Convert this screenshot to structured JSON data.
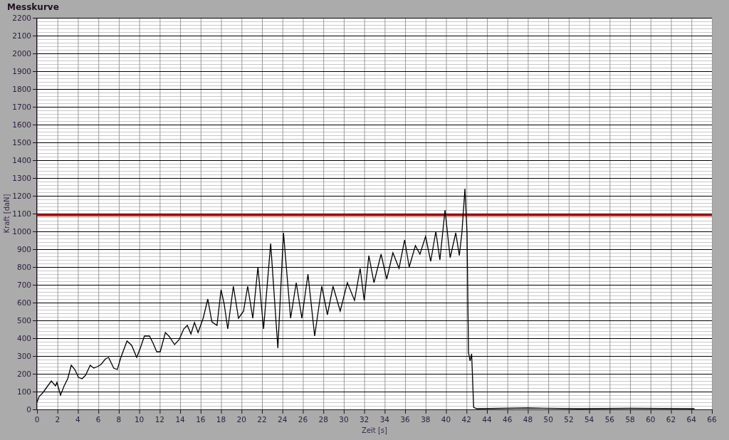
{
  "graph": {
    "title": "Messkurve",
    "chart_data": {
      "type": "line",
      "xlabel": "Zeit [s]",
      "ylabel": "Kraft [daN]",
      "x": [
        0,
        0.2,
        0.55,
        0.9,
        1.4,
        1.8,
        1.95,
        2.1,
        2.3,
        2.65,
        3.0,
        3.35,
        3.7,
        4.05,
        4.4,
        4.75,
        5.2,
        5.55,
        5.9,
        6.25,
        6.7,
        7.0,
        7.5,
        7.85,
        8.2,
        8.8,
        9.25,
        9.75,
        10.15,
        10.5,
        11.0,
        11.35,
        11.7,
        12.05,
        12.55,
        12.95,
        13.45,
        13.9,
        14.35,
        14.7,
        15.05,
        15.4,
        15.75,
        16.25,
        16.7,
        17.1,
        17.6,
        18.0,
        18.3,
        18.65,
        19.2,
        19.7,
        20.2,
        20.6,
        21.1,
        21.6,
        22.15,
        22.85,
        23.55,
        24.1,
        24.8,
        25.35,
        25.9,
        26.5,
        27.15,
        27.85,
        28.4,
        28.95,
        29.65,
        30.35,
        31.05,
        31.6,
        32.0,
        32.45,
        32.95,
        33.65,
        34.2,
        34.8,
        35.4,
        35.95,
        36.4,
        37.0,
        37.45,
        38.0,
        38.5,
        39.0,
        39.4,
        39.9,
        40.4,
        40.95,
        41.3,
        41.55,
        41.85,
        42.05,
        42.2,
        42.35,
        42.5,
        42.7,
        43.0,
        48.0,
        53.0,
        58.0,
        64.3
      ],
      "series": [
        {
          "color": "#000000",
          "values": [
            40,
            72,
            92,
            120,
            160,
            132,
            152,
            120,
            80,
            132,
            172,
            248,
            224,
            180,
            172,
            192,
            248,
            232,
            240,
            252,
            284,
            292,
            232,
            224,
            292,
            384,
            360,
            292,
            352,
            412,
            412,
            372,
            324,
            324,
            432,
            408,
            364,
            392,
            452,
            472,
            424,
            488,
            432,
            512,
            620,
            492,
            472,
            672,
            592,
            452,
            692,
            512,
            552,
            692,
            512,
            800,
            452,
            932,
            344,
            992,
            512,
            712,
            512,
            760,
            412,
            692,
            532,
            692,
            552,
            712,
            612,
            792,
            612,
            864,
            712,
            872,
            732,
            880,
            792,
            952,
            800,
            920,
            872,
            972,
            832,
            1000,
            840,
            1120,
            852,
            992,
            864,
            992,
            1240,
            992,
            320,
            272,
            312,
            12,
            4,
            8,
            4,
            6,
            4
          ]
        }
      ],
      "xlim": [
        0,
        66
      ],
      "ylim": [
        0,
        2200
      ],
      "xticks": [
        0,
        2,
        4,
        6,
        8,
        10,
        12,
        14,
        16,
        18,
        20,
        22,
        24,
        26,
        28,
        30,
        32,
        34,
        36,
        38,
        40,
        42,
        44,
        46,
        48,
        50,
        52,
        54,
        56,
        58,
        60,
        62,
        64,
        66
      ],
      "yticks": [
        0,
        100,
        200,
        300,
        400,
        500,
        600,
        700,
        800,
        900,
        1000,
        1100,
        1200,
        1300,
        1400,
        1500,
        1600,
        1700,
        1800,
        1900,
        2000,
        2100,
        2200
      ],
      "grid": true,
      "ref_lines": [
        {
          "axis": "y",
          "value": 1090,
          "color": "#cc2020"
        }
      ]
    }
  }
}
